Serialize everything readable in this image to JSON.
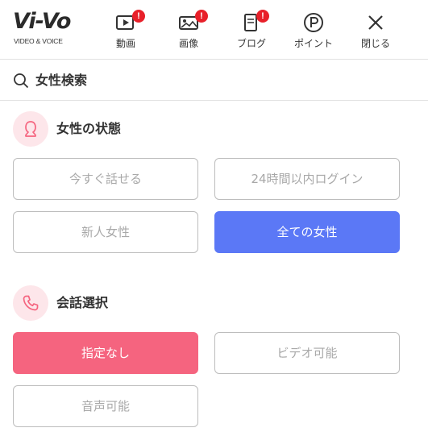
{
  "header": {
    "logo_main": "Vi-Vo",
    "logo_sub": "VIDEO & VOICE",
    "nav": [
      {
        "label": "動画",
        "icon": "video-icon",
        "badge": "!"
      },
      {
        "label": "画像",
        "icon": "image-icon",
        "badge": "!"
      },
      {
        "label": "ブログ",
        "icon": "blog-icon",
        "badge": "!"
      },
      {
        "label": "ポイント",
        "icon": "point-icon"
      },
      {
        "label": "閉じる",
        "icon": "close-icon"
      }
    ]
  },
  "search": {
    "title": "女性検索",
    "icon": "search-icon"
  },
  "sections": {
    "status": {
      "title": "女性の状態",
      "icon": "female-icon",
      "options": [
        "今すぐ話せる",
        "24時間以内ログイン",
        "新人女性",
        "全ての女性"
      ],
      "selected": "全ての女性"
    },
    "call": {
      "title": "会話選択",
      "icon": "phone-icon",
      "options": [
        "指定なし",
        "ビデオ可能",
        "音声可能"
      ],
      "selected": "指定なし"
    }
  },
  "colors": {
    "accent_blue": "#5b78f6",
    "accent_pink": "#f5647f",
    "badge_red": "#e8202a",
    "icon_bg_pink": "#fde6ea"
  }
}
